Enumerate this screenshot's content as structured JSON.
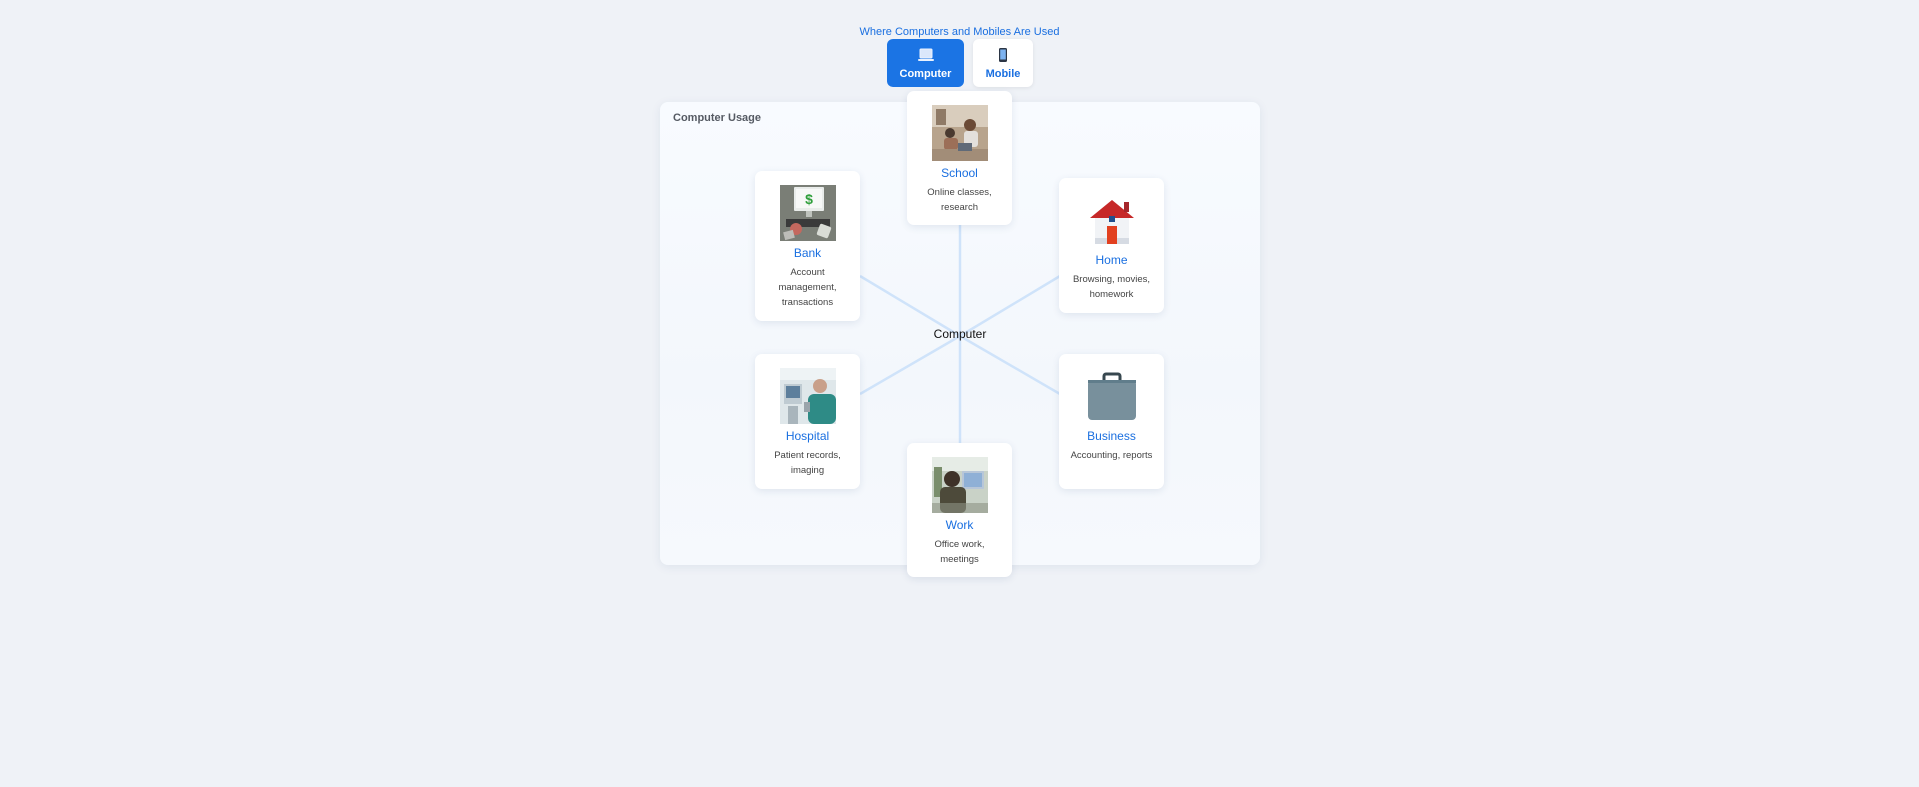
{
  "page": {
    "title": "Where Computers and Mobiles Are Used"
  },
  "toggle": {
    "computer_label": "Computer",
    "mobile_label": "Mobile",
    "selected": "Computer",
    "active_color": "#1b74e4"
  },
  "panel": {
    "title": "Computer Usage",
    "hub_label": "Computer"
  },
  "places": [
    {
      "name": "School",
      "description": "Online classes, research",
      "icon": "classroom-photo"
    },
    {
      "name": "Home",
      "description": "Browsing, movies, homework",
      "icon": "house-icon"
    },
    {
      "name": "Business",
      "description": "Accounting, reports",
      "icon": "briefcase-icon"
    },
    {
      "name": "Work",
      "description": "Office work, meetings",
      "icon": "office-worker-photo"
    },
    {
      "name": "Hospital",
      "description": "Patient records, imaging",
      "icon": "hospital-photo"
    },
    {
      "name": "Bank",
      "description": "Account management, transactions",
      "icon": "bank-computer-photo"
    }
  ],
  "colors": {
    "accent": "#1a6fe0",
    "spoke": "#cfe3fa",
    "background": "#eff2f7"
  }
}
